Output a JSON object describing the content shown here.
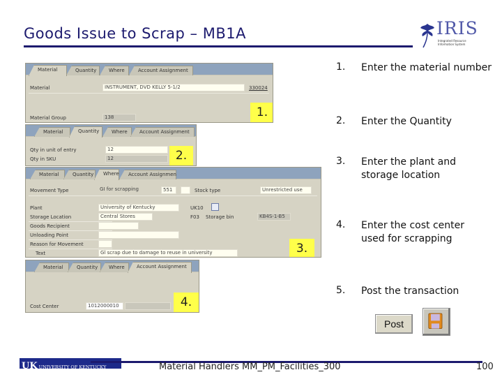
{
  "header": {
    "title": "Goods Issue to Scrap – MB1A",
    "logo": {
      "name": "IRIS",
      "subtitle": "Integrated Resource Information System"
    }
  },
  "screens": {
    "s1": {
      "tabs": [
        "Material",
        "Quantity",
        "Where",
        "Account Assignment"
      ],
      "active_tab": 0,
      "material_label": "Material",
      "material_value": "INSTRUMENT, DVD KELLY 5-1/2",
      "material_number": "330024",
      "material_group_label": "Material Group",
      "material_group_value": "138",
      "badge": "1."
    },
    "s2": {
      "tabs": [
        "Material",
        "Quantity",
        "Where",
        "Account Assignment"
      ],
      "active_tab": 1,
      "qty_unit_entry_label": "Qty in unit of entry",
      "qty_unit_entry_value": "12",
      "qty_sku_label": "Qty in SKU",
      "qty_sku_value": "12",
      "badge": "2."
    },
    "s3": {
      "tabs": [
        "Material",
        "Quantity",
        "Where",
        "Account Assignment"
      ],
      "active_tab": 2,
      "movement_type_label": "Movement Type",
      "movement_type_value": "GI for scrapping",
      "movement_type_code": "551",
      "stock_type_label": "Stock type",
      "stock_type_value": "Unrestricted use",
      "plant_label": "Plant",
      "plant_value": "University of Kentucky",
      "plant_code": "UK10",
      "storage_location_label": "Storage Location",
      "storage_location_value": "Central Stores",
      "storage_location_code": "F03",
      "storage_bin_label": "Storage bin",
      "storage_bin_value": "KB4S-1-B5",
      "goods_recipient_label": "Goods Recipient",
      "unloading_point_label": "Unloading Point",
      "reason_label": "Reason for Movement",
      "text_label": "Text",
      "text_value": "Gl scrap due to damage to reuse in university",
      "badge": "3."
    },
    "s4": {
      "tabs": [
        "Material",
        "Quantity",
        "Where",
        "Account Assignment"
      ],
      "active_tab": 3,
      "cost_center_label": "Cost Center",
      "cost_center_value": "1012000010",
      "badge": "4."
    }
  },
  "steps": [
    {
      "num": "1.",
      "text": "Enter the material number"
    },
    {
      "num": "2.",
      "text": "Enter the Quantity"
    },
    {
      "num": "3.",
      "text": "Enter the plant and storage location"
    },
    {
      "num": "4.",
      "text": "Enter the cost center used for scrapping"
    },
    {
      "num": "5.",
      "text": "Post the transaction"
    }
  ],
  "actions": {
    "post_label": "Post",
    "save_icon": "floppy-disk-icon"
  },
  "footer": {
    "logo_uk": "UK",
    "logo_text": "UNIVERSITY OF KENTUCKY",
    "course": "Material Handlers MM_PM_Facilities_300",
    "page": "100"
  }
}
